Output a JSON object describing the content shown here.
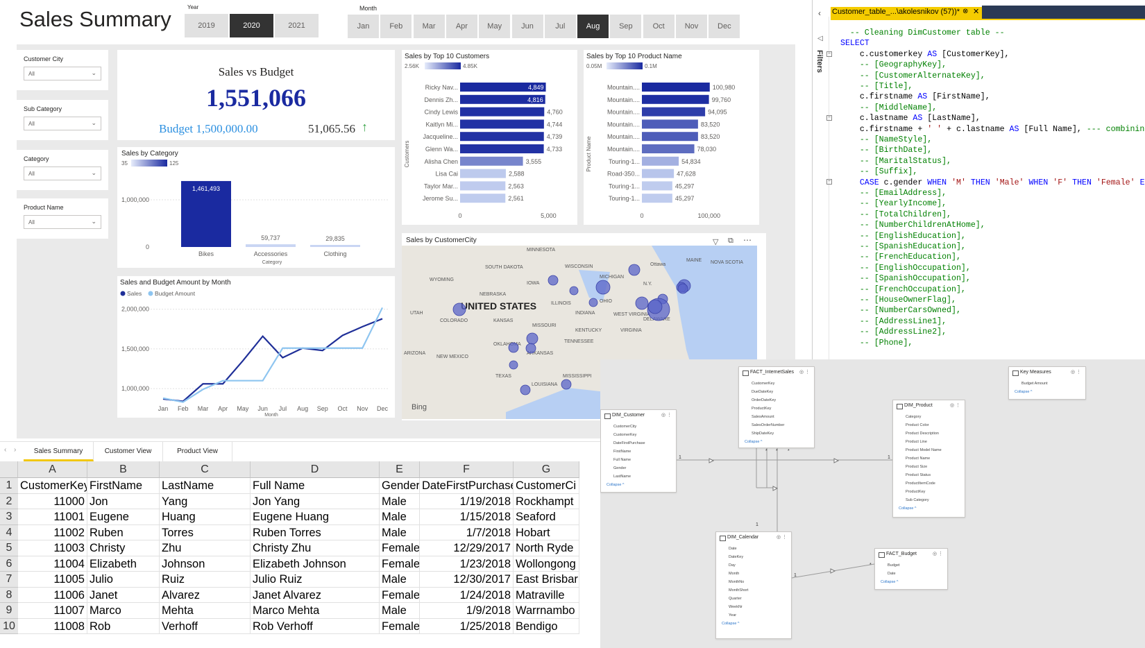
{
  "report": {
    "title": "Sales Summary",
    "year_label": "Year",
    "years": [
      "2019",
      "2020",
      "2021"
    ],
    "selected_year": "2020",
    "month_label": "Month",
    "months": [
      "Jan",
      "Feb",
      "Mar",
      "Apr",
      "May",
      "Jun",
      "Jul",
      "Aug",
      "Sep",
      "Oct",
      "Nov",
      "Dec"
    ],
    "selected_month": "Aug",
    "slicers": [
      {
        "label": "Customer City",
        "value": "All"
      },
      {
        "label": "Sub Category",
        "value": "All"
      },
      {
        "label": "Category",
        "value": "All"
      },
      {
        "label": "Product Name",
        "value": "All"
      }
    ],
    "kpi": {
      "title": "Sales vs Budget",
      "value": "1,551,066",
      "budget": "Budget 1,500,000.00",
      "variance": "51,065.56"
    },
    "tabs": [
      "Sales Summary",
      "Customer View",
      "Product View"
    ],
    "map_title": "Sales by CustomerCity",
    "map_labels": [
      "MINNESOTA",
      "WISCONSIN",
      "SOUTH DAKOTA",
      "MICHIGAN",
      "Ottawa",
      "MAINE",
      "NOVA SCOTIA",
      "WYOMING",
      "IOWA",
      "NEBRASKA",
      "ILLINOIS",
      "OHIO",
      "N.Y.",
      "UNITED STATES",
      "UTAH",
      "COLORADO",
      "KANSAS",
      "MISSOURI",
      "INDIANA",
      "WEST VIRGINIA",
      "DELAWARE",
      "KENTUCKY",
      "VIRGINIA",
      "TENNESSEE",
      "OKLAHOMA",
      "ARKANSAS",
      "ARIZONA",
      "NEW MEXICO",
      "TEXAS",
      "MISSISSIPPI",
      "LOUISIANA",
      "Bing"
    ]
  },
  "chart_data": [
    {
      "type": "bar",
      "title": "Sales by Category",
      "xlabel": "Category",
      "categories": [
        "Bikes",
        "Accessories",
        "Clothing"
      ],
      "values": [
        1461493,
        59737,
        29835
      ],
      "value_labels": [
        "1,461,493",
        "59,737",
        "29,835"
      ],
      "y_ticks": [
        "1,000,000",
        "0"
      ],
      "ylim": [
        0,
        1600000
      ],
      "legend_range": [
        "35",
        "125"
      ]
    },
    {
      "type": "bar",
      "orientation": "horizontal",
      "title": "Sales by Top 10 Customers",
      "ylabel": "Customers",
      "categories": [
        "Ricky Nav...",
        "Dennis Zh...",
        "Cindy Lewis",
        "Kaitlyn Mi...",
        "Jacqueline...",
        "Glenn Wa...",
        "Alisha Chen",
        "Lisa Cai",
        "Taylor Mar...",
        "Jerome Su..."
      ],
      "values": [
        4849,
        4816,
        4760,
        4744,
        4739,
        4733,
        3555,
        2588,
        2563,
        2561
      ],
      "value_labels": [
        "4,849",
        "4,816",
        "4,760",
        "4,744",
        "4,739",
        "4,733",
        "3,555",
        "2,588",
        "2,563",
        "2,561"
      ],
      "x_ticks": [
        "0",
        "5,000"
      ],
      "xlim": [
        0,
        5000
      ],
      "legend_range": [
        "2.56K",
        "4.85K"
      ]
    },
    {
      "type": "bar",
      "orientation": "horizontal",
      "title": "Sales by Top 10 Product Name",
      "ylabel": "Product Name",
      "categories": [
        "Mountain....",
        "Mountain....",
        "Mountain....",
        "Mountain....",
        "Mountain....",
        "Mountain....",
        "Touring-1...",
        "Road-350...",
        "Touring-1...",
        "Touring-1..."
      ],
      "values": [
        100980,
        99760,
        94095,
        83520,
        83520,
        78030,
        54834,
        47628,
        45297,
        45297
      ],
      "value_labels": [
        "100,980",
        "99,760",
        "94,095",
        "83,520",
        "83,520",
        "78,030",
        "54,834",
        "47,628",
        "45,297",
        "45,297"
      ],
      "x_ticks": [
        "0",
        "100,000"
      ],
      "xlim": [
        0,
        120000
      ],
      "legend_range": [
        "0.05M",
        "0.1M"
      ]
    },
    {
      "type": "line",
      "title": "Sales and Budget Amount by Month",
      "xlabel": "Month",
      "categories": [
        "Jan",
        "Feb",
        "Mar",
        "Apr",
        "May",
        "Jun",
        "Jul",
        "Aug",
        "Sep",
        "Oct",
        "Nov",
        "Dec"
      ],
      "y_ticks": [
        "2,000,000",
        "1,500,000",
        "1,000,000"
      ],
      "ylim": [
        800000,
        2050000
      ],
      "series": [
        {
          "name": "Sales",
          "color": "#1f2f98",
          "values": [
            870000,
            840000,
            1060000,
            1060000,
            1350000,
            1660000,
            1390000,
            1510000,
            1480000,
            1670000,
            1780000,
            1880000
          ]
        },
        {
          "name": "Budget Amount",
          "color": "#8ec5f0",
          "values": [
            880000,
            830000,
            990000,
            1100000,
            1100000,
            1100000,
            1510000,
            1510000,
            1510000,
            1510000,
            1510000,
            2020000
          ]
        }
      ]
    }
  ],
  "sql": {
    "tab_title": "Customer_table_...\\akolesnikov (57))*",
    "lines": [
      {
        "t": "  -- Cleaning DimCustomer table --",
        "c": "cm"
      },
      {
        "t": "SELECT",
        "c": "kw"
      },
      {
        "t": "    c.customerkey AS [CustomerKey],",
        "c": ""
      },
      {
        "t": "    -- [GeographyKey],",
        "c": "cm"
      },
      {
        "t": "    -- [CustomerAlternateKey],",
        "c": "cm"
      },
      {
        "t": "    -- [Title],",
        "c": "cm"
      },
      {
        "t": "    c.firstname AS [FirstName],",
        "c": ""
      },
      {
        "t": "    -- [MiddleName],",
        "c": "cm"
      },
      {
        "t": "    c.lastname AS [LastName],",
        "c": ""
      },
      {
        "t": "    c.firstname + ' ' + c.lastname AS [Full Name], --- combining first",
        "c": ""
      },
      {
        "t": "    -- [NameStyle],",
        "c": "cm"
      },
      {
        "t": "    -- [BirthDate],",
        "c": "cm"
      },
      {
        "t": "    -- [MaritalStatus],",
        "c": "cm"
      },
      {
        "t": "    -- [Suffix],",
        "c": "cm"
      },
      {
        "t": "    CASE c.gender WHEN 'M' THEN 'Male' WHEN 'F' THEN 'Female' END AS",
        "c": ""
      },
      {
        "t": "    -- [EmailAddress],",
        "c": "cm"
      },
      {
        "t": "    -- [YearlyIncome],",
        "c": "cm"
      },
      {
        "t": "    -- [TotalChildren],",
        "c": "cm"
      },
      {
        "t": "    -- [NumberChildrenAtHome],",
        "c": "cm"
      },
      {
        "t": "    -- [EnglishEducation],",
        "c": "cm"
      },
      {
        "t": "    -- [SpanishEducation],",
        "c": "cm"
      },
      {
        "t": "    -- [FrenchEducation],",
        "c": "cm"
      },
      {
        "t": "    -- [EnglishOccupation],",
        "c": "cm"
      },
      {
        "t": "    -- [SpanishOccupation],",
        "c": "cm"
      },
      {
        "t": "    -- [FrenchOccupation],",
        "c": "cm"
      },
      {
        "t": "    -- [HouseOwnerFlag],",
        "c": "cm"
      },
      {
        "t": "    -- [NumberCarsOwned],",
        "c": "cm"
      },
      {
        "t": "    -- [AddressLine1],",
        "c": "cm"
      },
      {
        "t": "    -- [AddressLine2],",
        "c": "cm"
      },
      {
        "t": "    -- [Phone],",
        "c": "cm"
      }
    ],
    "filters_label": "Filters"
  },
  "excel": {
    "col_letters": [
      "A",
      "B",
      "C",
      "D",
      "E",
      "F",
      "G"
    ],
    "headers": [
      "CustomerKey",
      "FirstName",
      "LastName",
      "Full Name",
      "Gender",
      "DateFirstPurchase",
      "CustomerCi"
    ],
    "rows": [
      [
        "11000",
        "Jon",
        "Yang",
        "Jon Yang",
        "Male",
        "1/19/2018",
        "Rockhampt"
      ],
      [
        "11001",
        "Eugene",
        "Huang",
        "Eugene Huang",
        "Male",
        "1/15/2018",
        "Seaford"
      ],
      [
        "11002",
        "Ruben",
        "Torres",
        "Ruben Torres",
        "Male",
        "1/7/2018",
        "Hobart"
      ],
      [
        "11003",
        "Christy",
        "Zhu",
        "Christy Zhu",
        "Female",
        "12/29/2017",
        "North Ryde"
      ],
      [
        "11004",
        "Elizabeth",
        "Johnson",
        "Elizabeth Johnson",
        "Female",
        "1/23/2018",
        "Wollongong"
      ],
      [
        "11005",
        "Julio",
        "Ruiz",
        "Julio Ruiz",
        "Male",
        "12/30/2017",
        "East Brisbar"
      ],
      [
        "11006",
        "Janet",
        "Alvarez",
        "Janet Alvarez",
        "Female",
        "1/24/2018",
        "Matraville"
      ],
      [
        "11007",
        "Marco",
        "Mehta",
        "Marco Mehta",
        "Male",
        "1/9/2018",
        "Warrnambo"
      ],
      [
        "11008",
        "Rob",
        "Verhoff",
        "Rob Verhoff",
        "Female",
        "1/25/2018",
        "Bendigo"
      ]
    ]
  },
  "model": {
    "tables": [
      {
        "name": "FACT_InternetSales",
        "fields": [
          "CustomerKey",
          "DueDateKey",
          "OrderDateKey",
          "ProductKey",
          "SalesAmount",
          "SalesOrderNumber",
          "ShipDateKey"
        ]
      },
      {
        "name": "Key Measures",
        "fields": [
          "Budget Amount"
        ]
      },
      {
        "name": "DIM_Customer",
        "fields": [
          "CustomerCity",
          "CustomerKey",
          "DateFirstPurchase",
          "FirstName",
          "Full Name",
          "Gender",
          "LastName"
        ]
      },
      {
        "name": "DIM_Product",
        "fields": [
          "Category",
          "Product Color",
          "Product Description",
          "Product Line",
          "Product Model Name",
          "Product Name",
          "Product Size",
          "Product Status",
          "ProductItemCode",
          "ProductKey",
          "Sub Category"
        ]
      },
      {
        "name": "DIM_Calendar",
        "fields": [
          "Date",
          "DateKey",
          "Day",
          "Month",
          "MonthNo",
          "MonthShort",
          "Quarter",
          "WeekNr",
          "Year"
        ]
      },
      {
        "name": "FACT_Budget",
        "fields": [
          "Budget",
          "Date"
        ]
      }
    ],
    "collapse_label": "Collapse ^",
    "rel_one": "1",
    "rel_many": "*"
  }
}
